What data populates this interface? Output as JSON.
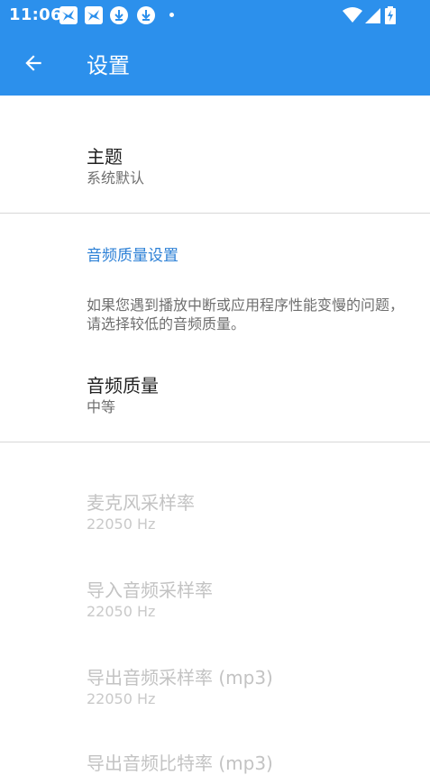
{
  "status_bar": {
    "time": "11:06"
  },
  "toolbar": {
    "title": "设置"
  },
  "preferences": {
    "theme": {
      "title": "主题",
      "summary": "系统默认"
    },
    "audio_quality_category": "音频质量设置",
    "audio_quality_description": "如果您遇到播放中断或应用程序性能变慢的问题，请选择较低的音频质量。",
    "audio_quality": {
      "title": "音频质量",
      "summary": "中等"
    },
    "mic_sample_rate": {
      "title": "麦克风采样率",
      "summary": "22050 Hz"
    },
    "import_sample_rate": {
      "title": "导入音频采样率",
      "summary": "22050 Hz"
    },
    "export_sample_rate": {
      "title": "导出音频采样率 (mp3)",
      "summary": "22050 Hz"
    },
    "export_bitrate": {
      "title": "导出音频比特率 (mp3)"
    }
  },
  "icons": [
    "bird-icon",
    "bird-icon",
    "download-icon",
    "download-icon",
    "wifi-icon",
    "signal-icon",
    "battery-charging-icon",
    "back-arrow-icon"
  ],
  "colors": {
    "primary": "#2c90ec",
    "accent": "#2c80d6",
    "disabled_text": "#c3c3c3"
  }
}
